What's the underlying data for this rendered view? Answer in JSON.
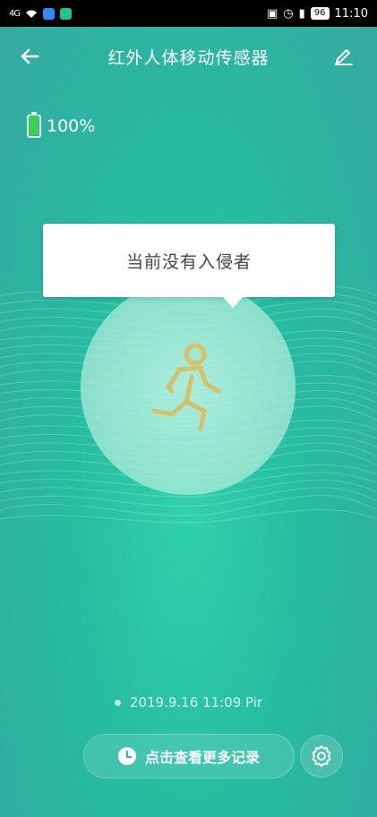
{
  "status_bar": {
    "signal": "4G",
    "battery_level": "96",
    "time": "11:10",
    "icons": [
      "signal-icon",
      "wifi-icon",
      "app-notification-icon",
      "nfc-icon",
      "alarm-icon",
      "vibrate-icon",
      "battery-icon"
    ]
  },
  "header": {
    "title": "红外人体移动传感器",
    "back_icon": "arrow-left-icon",
    "edit_icon": "pencil-icon"
  },
  "device": {
    "battery_text": "100%",
    "battery_fraction": 1.0,
    "battery_color": "#3ed14f"
  },
  "status": {
    "message": "当前没有入侵者",
    "figure_icon": "running-person-icon",
    "figure_color": "#d7c06a"
  },
  "last_record": "2019.9.16 11:09 Pir",
  "actions": {
    "history_label": "点击查看更多记录",
    "history_icon": "clock-icon",
    "settings_icon": "gear-icon"
  },
  "colors": {
    "background": "#2bc3a6",
    "accent": "#ffffff"
  }
}
